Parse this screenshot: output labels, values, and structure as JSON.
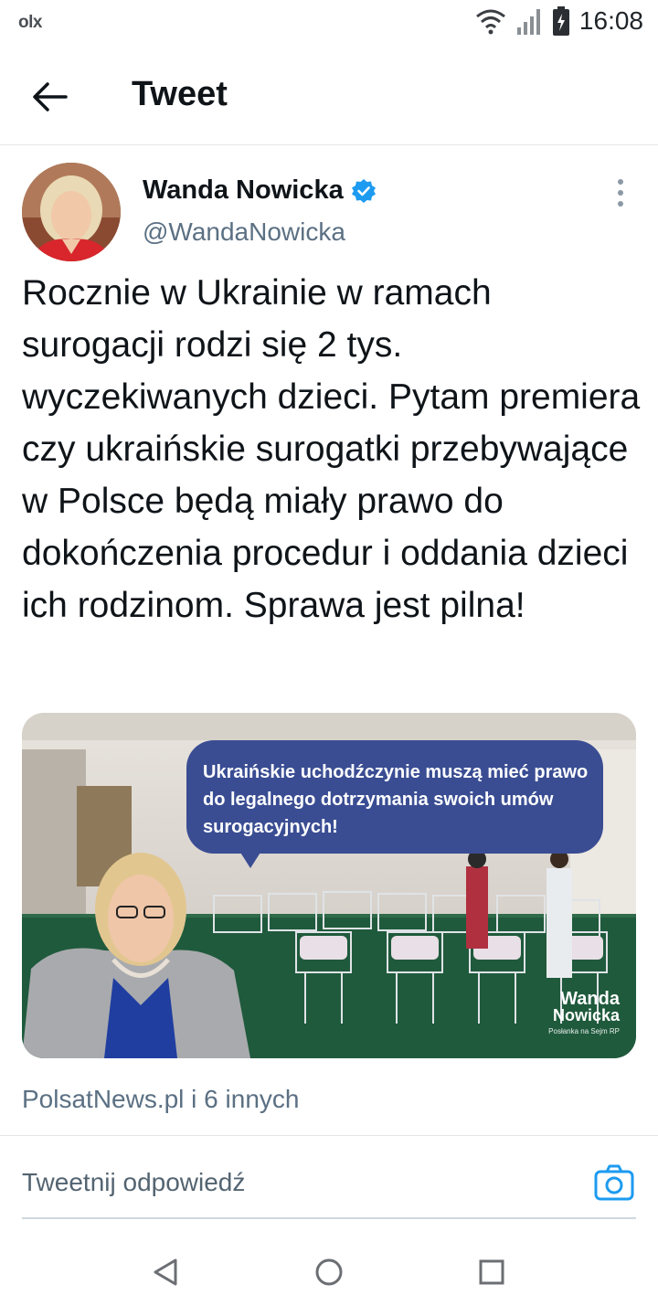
{
  "status_bar": {
    "app_logo": "olx",
    "time": "16:08",
    "icons": [
      "wifi-icon",
      "signal-icon",
      "battery-icon"
    ]
  },
  "header": {
    "title": "Tweet",
    "back_icon": "arrow-left-icon"
  },
  "tweet": {
    "author_name": "Wanda Nowicka",
    "author_handle": "@WandaNowicka",
    "verified": true,
    "text": "Rocznie w Ukrainie w ramach surogacji rodzi się 2 tys. wyczekiwanych dzieci. Pytam premiera czy ukraińskie surogatki przebywające w Polsce będą miały prawo do dokończenia procedur i oddania dzieci ich rodzinom. Sprawa jest pilna!",
    "media": {
      "bubble_text": "Ukraińskie uchodźczynie muszą mieć prawo do legalnego dotrzymania swoich umów surogacyjnych!",
      "watermark_line1": "Wanda",
      "watermark_line2": "Nowicka",
      "watermark_line3": "Posłanka na Sejm RP"
    },
    "source_line": "PolsatNews.pl i 6 innych"
  },
  "reply_bar": {
    "placeholder": "Tweetnij odpowiedź"
  },
  "colors": {
    "accent": "#1d9bf0",
    "text": "#0f1419",
    "secondary_text": "#5b7083",
    "bubble": "#3a4d93"
  }
}
